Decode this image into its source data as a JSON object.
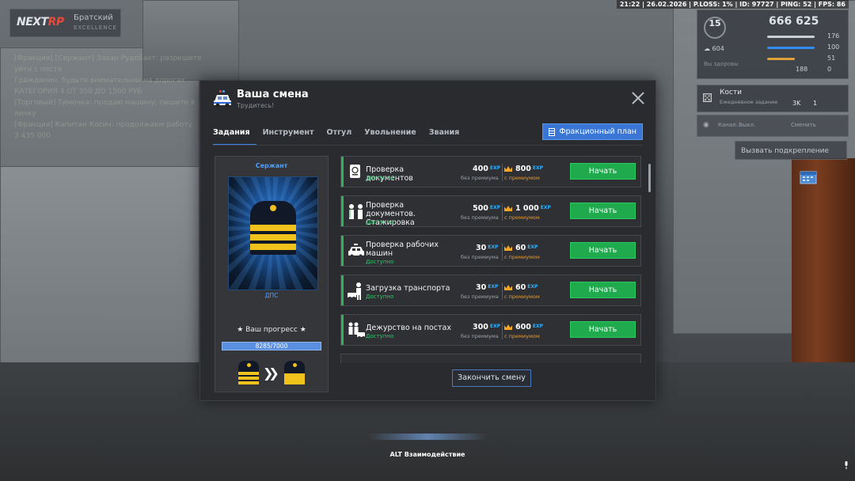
{
  "hud": {
    "logo": {
      "part1": "NEXT",
      "part2": "RP"
    },
    "server_name": "Братский",
    "server_sub": "EXCELLENCE",
    "status_line": "21:22 | 26.02.2026 | P.LOSS: 1% | ID: 97727 | PING: 52 | FPS: 86",
    "level": "15",
    "money": "666 625",
    "bank": "604",
    "health": "100",
    "armor": "51",
    "hunger": "176",
    "thirst": "188",
    "stat8": "0",
    "health_label": "Вы здоровы",
    "quest": {
      "title": "Кости",
      "subtitle": "Ежедневное задание",
      "value": "3K",
      "count": "1"
    },
    "voice": {
      "channel_label": "Канал:",
      "channel_value": "Выкл.",
      "change": "Сменить"
    },
    "backup_label": "Вызвать подкрепление"
  },
  "chat": {
    "lines": [
      "[Фракция] [Сержант] Захар Рудобахт: разрешите уйти с поста",
      "Гражданин, будьте внимательны на дорогах",
      "КАТЕГОРИЯ 4 ОТ 350 ДО 1500 РУБ",
      "[Торговый] Тимочка: продаю машину, пишите в личку",
      "[Фракция] Капитан Косич: продолжаем работу",
      "3 435 000"
    ]
  },
  "modal": {
    "title": "Ваша смена",
    "subtitle": "Трудитесь!",
    "tabs": [
      "Задания",
      "Инструмент",
      "Отгул",
      "Увольнение",
      "Звания"
    ],
    "plan_button": "Фракционный план",
    "rank": {
      "title": "Сержант",
      "dept": "ДПС",
      "progress_label": "★ Ваш прогресс ★",
      "progress_text": "8285/7000",
      "progress_fraction": 1.0
    },
    "tasks": [
      {
        "name": "Проверка документов",
        "status": "Доступно",
        "exp_base": "400",
        "exp_premium": "800",
        "icon": "passport-icon"
      },
      {
        "name": "Проверка документов. Стажировка",
        "status": "Доступно",
        "exp_base": "500",
        "exp_premium": "1 000",
        "icon": "officers-icon"
      },
      {
        "name": "Проверка рабочих машин",
        "status": "Доступно",
        "exp_base": "30",
        "exp_premium": "60",
        "icon": "police-car-icon"
      },
      {
        "name": "Загрузка транспорта",
        "status": "Доступно",
        "exp_base": "30",
        "exp_premium": "60",
        "icon": "loading-icon"
      },
      {
        "name": "Дежурство на постах",
        "status": "Доступно",
        "exp_base": "300",
        "exp_premium": "600",
        "icon": "patrol-icon"
      }
    ],
    "exp_tag": "EXP",
    "base_label": "без премиума",
    "premium_label": "с премиумом",
    "start_label": "Начать",
    "end_shift": "Закончить смену"
  },
  "bottom": {
    "alt_hint": "ALT Взаимодействие"
  }
}
